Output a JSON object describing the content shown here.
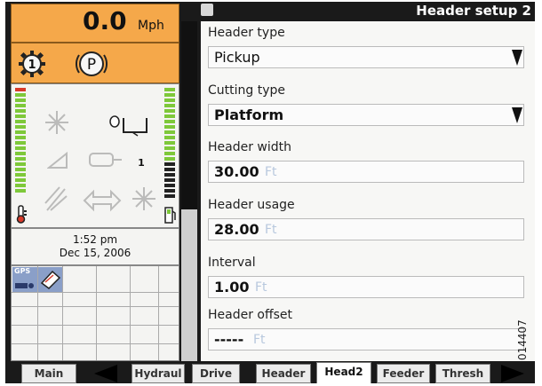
{
  "status": {
    "speed_value": "0.0",
    "speed_unit": "Mph",
    "gear_number": "1",
    "park_label": "P",
    "header_position": "1"
  },
  "datetime": {
    "time": "1:52 pm",
    "date": "Dec 15, 2006"
  },
  "gps": {
    "label": "GPS"
  },
  "title": "Header setup 2",
  "fields": [
    {
      "label": "Header type",
      "value": "Pickup",
      "unit": "",
      "dropdown": true
    },
    {
      "label": "Cutting type",
      "value": "Platform",
      "unit": "",
      "dropdown": true
    },
    {
      "label": "Header width",
      "value": "30.00",
      "unit": "Ft",
      "dropdown": false
    },
    {
      "label": "Header usage",
      "value": "28.00",
      "unit": "Ft",
      "dropdown": false
    },
    {
      "label": "Interval",
      "value": "1.00",
      "unit": "Ft",
      "dropdown": false
    },
    {
      "label": "Header offset",
      "value": "-----",
      "unit": "Ft",
      "dropdown": false
    }
  ],
  "tabs": {
    "main": "Main",
    "hydraul": "Hydraul",
    "drive": "Drive",
    "header": "Header",
    "head2": "Head2",
    "feeder": "Feeder",
    "thresh": "Thresh"
  },
  "watermark": "014407",
  "colors": {
    "status_orange": "#f5a84a",
    "level_green": "#7ec83a",
    "level_red": "#d83a2a",
    "unit_blue": "#b8c8de"
  }
}
